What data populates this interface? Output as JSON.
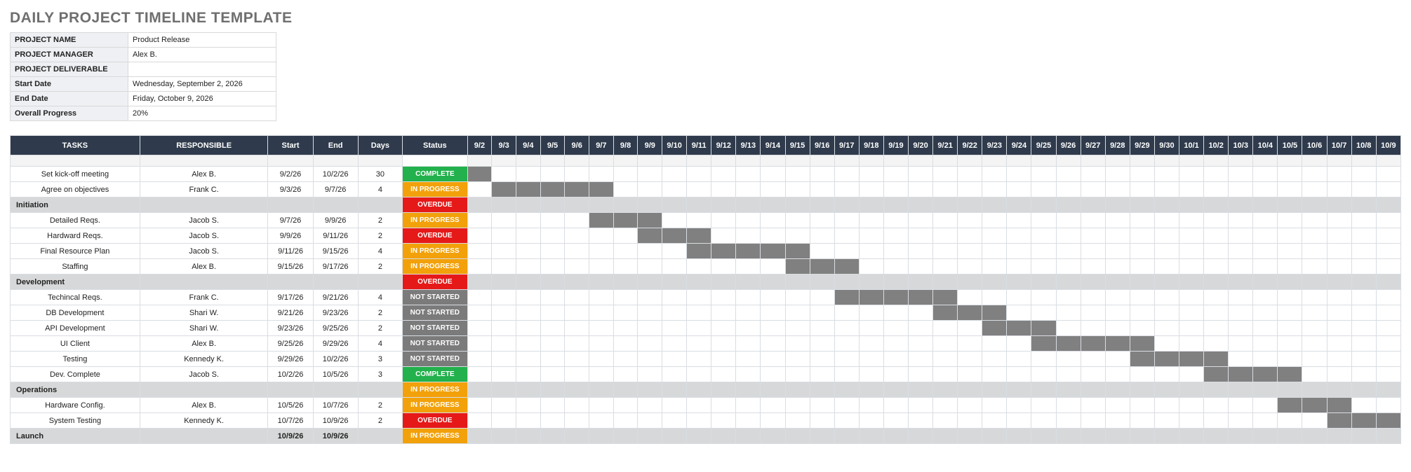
{
  "title": "DAILY PROJECT TIMELINE TEMPLATE",
  "meta": [
    {
      "label": "PROJECT NAME",
      "value": "Product Release"
    },
    {
      "label": "PROJECT MANAGER",
      "value": "Alex B."
    },
    {
      "label": "PROJECT DELIVERABLE",
      "value": ""
    },
    {
      "label": "Start Date",
      "value": "Wednesday, September 2, 2026"
    },
    {
      "label": "End Date",
      "value": "Friday, October 9, 2026"
    },
    {
      "label": "Overall Progress",
      "value": "20%"
    }
  ],
  "headers": {
    "tasks": "TASKS",
    "responsible": "RESPONSIBLE",
    "start": "Start",
    "end": "End",
    "days": "Days",
    "status": "Status"
  },
  "status_labels": {
    "complete": "COMPLETE",
    "inprogress": "IN PROGRESS",
    "overdue": "OVERDUE",
    "notstarted": "NOT STARTED"
  },
  "days": [
    "9/2",
    "9/3",
    "9/4",
    "9/5",
    "9/6",
    "9/7",
    "9/8",
    "9/9",
    "9/10",
    "9/11",
    "9/12",
    "9/13",
    "9/14",
    "9/15",
    "9/16",
    "9/17",
    "9/18",
    "9/19",
    "9/20",
    "9/21",
    "9/22",
    "9/23",
    "9/24",
    "9/25",
    "9/26",
    "9/27",
    "9/28",
    "9/29",
    "9/30",
    "10/1",
    "10/2",
    "10/3",
    "10/4",
    "10/5",
    "10/6",
    "10/7",
    "10/8",
    "10/9"
  ],
  "rows": [
    {
      "type": "spacer"
    },
    {
      "type": "task",
      "task": "Set kick-off meeting",
      "resp": "Alex B.",
      "start": "9/2/26",
      "end": "10/2/26",
      "days": "30",
      "status": "complete",
      "barStart": 0,
      "barSpan": 1
    },
    {
      "type": "task",
      "task": "Agree on objectives",
      "resp": "Frank C.",
      "start": "9/3/26",
      "end": "9/7/26",
      "days": "4",
      "status": "inprogress",
      "barStart": 1,
      "barSpan": 5
    },
    {
      "type": "section",
      "task": "Initiation",
      "status": "overdue"
    },
    {
      "type": "task",
      "task": "Detailed Reqs.",
      "resp": "Jacob S.",
      "start": "9/7/26",
      "end": "9/9/26",
      "days": "2",
      "status": "inprogress",
      "barStart": 5,
      "barSpan": 3
    },
    {
      "type": "task",
      "task": "Hardward Reqs.",
      "resp": "Jacob S.",
      "start": "9/9/26",
      "end": "9/11/26",
      "days": "2",
      "status": "overdue",
      "barStart": 7,
      "barSpan": 3
    },
    {
      "type": "task",
      "task": "Final Resource Plan",
      "resp": "Jacob S.",
      "start": "9/11/26",
      "end": "9/15/26",
      "days": "4",
      "status": "inprogress",
      "barStart": 9,
      "barSpan": 5
    },
    {
      "type": "task",
      "task": "Staffing",
      "resp": "Alex B.",
      "start": "9/15/26",
      "end": "9/17/26",
      "days": "2",
      "status": "inprogress",
      "barStart": 13,
      "barSpan": 3
    },
    {
      "type": "section",
      "task": "Development",
      "status": "overdue"
    },
    {
      "type": "task",
      "task": "Techincal Reqs.",
      "resp": "Frank C.",
      "start": "9/17/26",
      "end": "9/21/26",
      "days": "4",
      "status": "notstarted",
      "barStart": 15,
      "barSpan": 5
    },
    {
      "type": "task",
      "task": "DB Development",
      "resp": "Shari W.",
      "start": "9/21/26",
      "end": "9/23/26",
      "days": "2",
      "status": "notstarted",
      "barStart": 19,
      "barSpan": 3
    },
    {
      "type": "task",
      "task": "API Development",
      "resp": "Shari W.",
      "start": "9/23/26",
      "end": "9/25/26",
      "days": "2",
      "status": "notstarted",
      "barStart": 21,
      "barSpan": 3
    },
    {
      "type": "task",
      "task": "UI Client",
      "resp": "Alex B.",
      "start": "9/25/26",
      "end": "9/29/26",
      "days": "4",
      "status": "notstarted",
      "barStart": 23,
      "barSpan": 5
    },
    {
      "type": "task",
      "task": "Testing",
      "resp": "Kennedy K.",
      "start": "9/29/26",
      "end": "10/2/26",
      "days": "3",
      "status": "notstarted",
      "barStart": 27,
      "barSpan": 4
    },
    {
      "type": "task",
      "task": "Dev. Complete",
      "resp": "Jacob S.",
      "start": "10/2/26",
      "end": "10/5/26",
      "days": "3",
      "status": "complete",
      "barStart": 30,
      "barSpan": 4
    },
    {
      "type": "section",
      "task": "Operations",
      "status": "inprogress"
    },
    {
      "type": "task",
      "task": "Hardware Config.",
      "resp": "Alex B.",
      "start": "10/5/26",
      "end": "10/7/26",
      "days": "2",
      "status": "inprogress",
      "barStart": 33,
      "barSpan": 3
    },
    {
      "type": "task",
      "task": "System Testing",
      "resp": "Kennedy K.",
      "start": "10/7/26",
      "end": "10/9/26",
      "days": "2",
      "status": "overdue",
      "barStart": 35,
      "barSpan": 3
    },
    {
      "type": "section",
      "task": "Launch",
      "start": "10/9/26",
      "end": "10/9/26",
      "status": "inprogress"
    }
  ]
}
